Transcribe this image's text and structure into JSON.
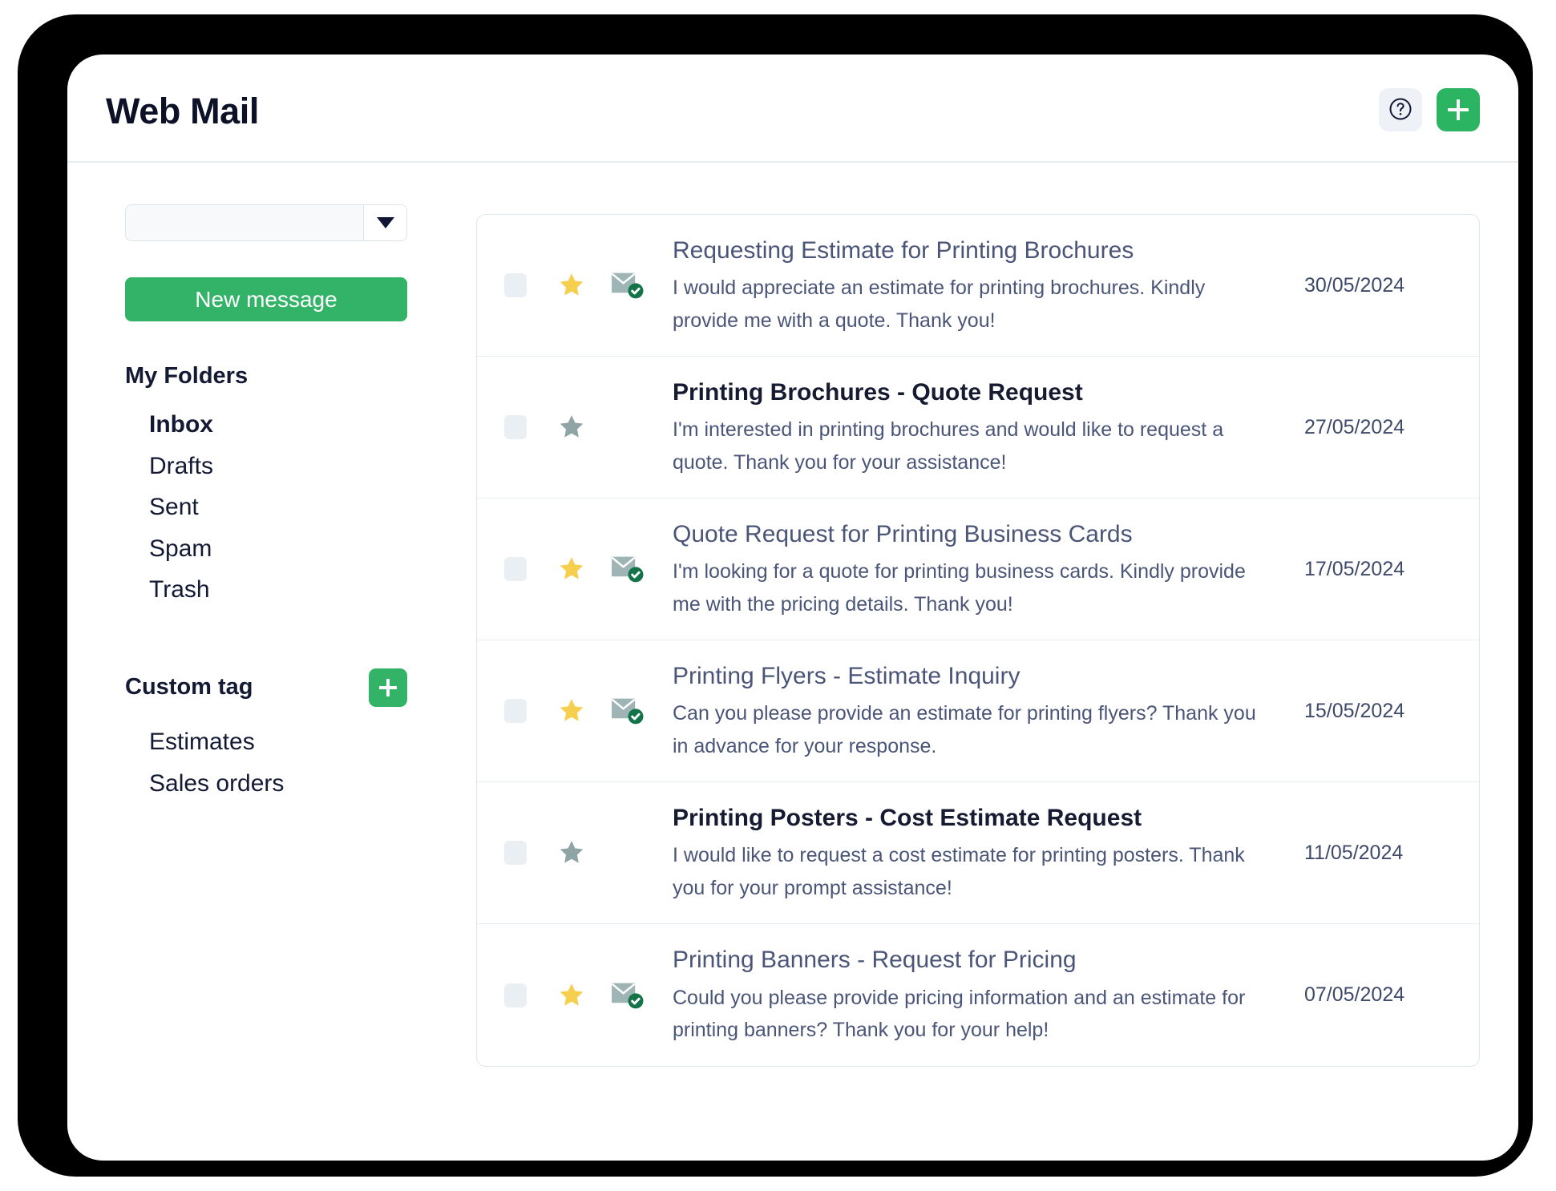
{
  "header": {
    "title": "Web Mail",
    "help_icon": "question-circle-icon",
    "help_label": "?",
    "add_icon": "plus-icon"
  },
  "sidebar": {
    "folder_select": {
      "value": "",
      "placeholder": "",
      "arrow_icon": "chevron-down-icon"
    },
    "new_message_label": "New message",
    "my_folders_heading": "My Folders",
    "folders": [
      {
        "label": "Inbox",
        "active": true
      },
      {
        "label": "Drafts",
        "active": false
      },
      {
        "label": "Sent",
        "active": false
      },
      {
        "label": "Spam",
        "active": false
      },
      {
        "label": "Trash",
        "active": false
      }
    ],
    "custom_tag_heading": "Custom tag",
    "add_tag_icon": "plus-icon",
    "tags": [
      {
        "label": "Estimates"
      },
      {
        "label": "Sales orders"
      }
    ]
  },
  "mail_list": {
    "rows": [
      {
        "subject": "Requesting Estimate for Printing Brochures",
        "preview": "I would appreciate an estimate for printing brochures.  Kindly provide me with a quote. Thank you!",
        "date": "30/05/2024",
        "unread": false,
        "starred": true,
        "has_status_icon": true,
        "status_icon": "envelope-check-icon"
      },
      {
        "subject": "Printing Brochures - Quote Request",
        "preview": "I'm interested in printing brochures and would like to request a quote. Thank you for your assistance!",
        "date": "27/05/2024",
        "unread": true,
        "starred": false,
        "has_status_icon": false,
        "status_icon": ""
      },
      {
        "subject": "Quote Request for Printing Business Cards",
        "preview": "I'm looking for a quote for printing business cards. Kindly provide me with the pricing details. Thank you!",
        "date": "17/05/2024",
        "unread": false,
        "starred": true,
        "has_status_icon": true,
        "status_icon": "envelope-check-icon"
      },
      {
        "subject": "Printing Flyers - Estimate Inquiry",
        "preview": "Can you please provide an estimate for printing flyers? Thank you in advance for your response.",
        "date": "15/05/2024",
        "unread": false,
        "starred": true,
        "has_status_icon": true,
        "status_icon": "envelope-check-icon"
      },
      {
        "subject": "Printing Posters - Cost Estimate Request",
        "preview": "I would like to request a cost estimate for printing posters. Thank you for your prompt assistance!",
        "date": "11/05/2024",
        "unread": true,
        "starred": false,
        "has_status_icon": false,
        "status_icon": ""
      },
      {
        "subject": "Printing Banners - Request for Pricing",
        "preview": "Could you please provide pricing information and an estimate for printing banners? Thank you for your help!",
        "date": "07/05/2024",
        "unread": false,
        "starred": true,
        "has_status_icon": true,
        "status_icon": "envelope-check-icon"
      }
    ]
  },
  "colors": {
    "accent_green": "#33b367",
    "star_active": "#f6cf4e",
    "star_inactive": "#8fa5a5",
    "envelope": "#9fb5b5",
    "check_badge": "#147449",
    "text_dark": "#141a34",
    "text_muted": "#4a5578"
  }
}
